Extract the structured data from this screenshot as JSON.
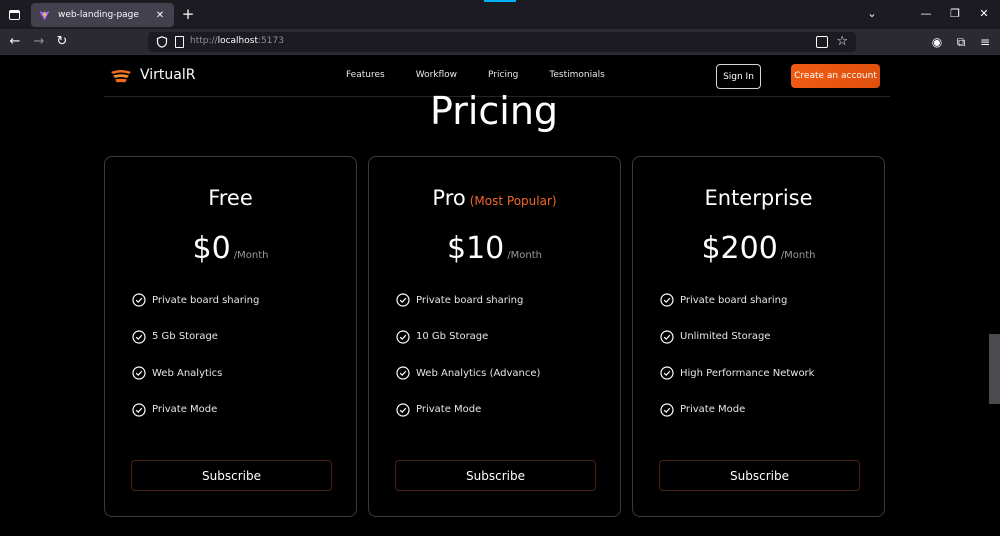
{
  "browser": {
    "tab_title": "web-landing-page",
    "url_prefix": "http://",
    "url_host": "localhost",
    "url_port": ":5173"
  },
  "site": {
    "brand": "VirtualR",
    "nav": [
      "Features",
      "Workflow",
      "Pricing",
      "Testimonials"
    ],
    "sign_in": "Sign In",
    "create_account": "Create an account",
    "accent_color": "#ef5b13"
  },
  "pricing": {
    "title": "Pricing",
    "plans": [
      {
        "name": "Free",
        "badge": "",
        "price": "$0",
        "period": "/Month",
        "features": [
          "Private board sharing",
          "5 Gb Storage",
          "Web Analytics",
          "Private Mode"
        ],
        "cta": "Subscribe"
      },
      {
        "name": "Pro",
        "badge": "(Most Popular)",
        "price": "$10",
        "period": "/Month",
        "features": [
          "Private board sharing",
          "10 Gb Storage",
          "Web Analytics (Advance)",
          "Private Mode"
        ],
        "cta": "Subscribe"
      },
      {
        "name": "Enterprise",
        "badge": "",
        "price": "$200",
        "period": "/Month",
        "features": [
          "Private board sharing",
          "Unlimited Storage",
          "High Performance Network",
          "Private Mode"
        ],
        "cta": "Subscribe"
      }
    ]
  }
}
